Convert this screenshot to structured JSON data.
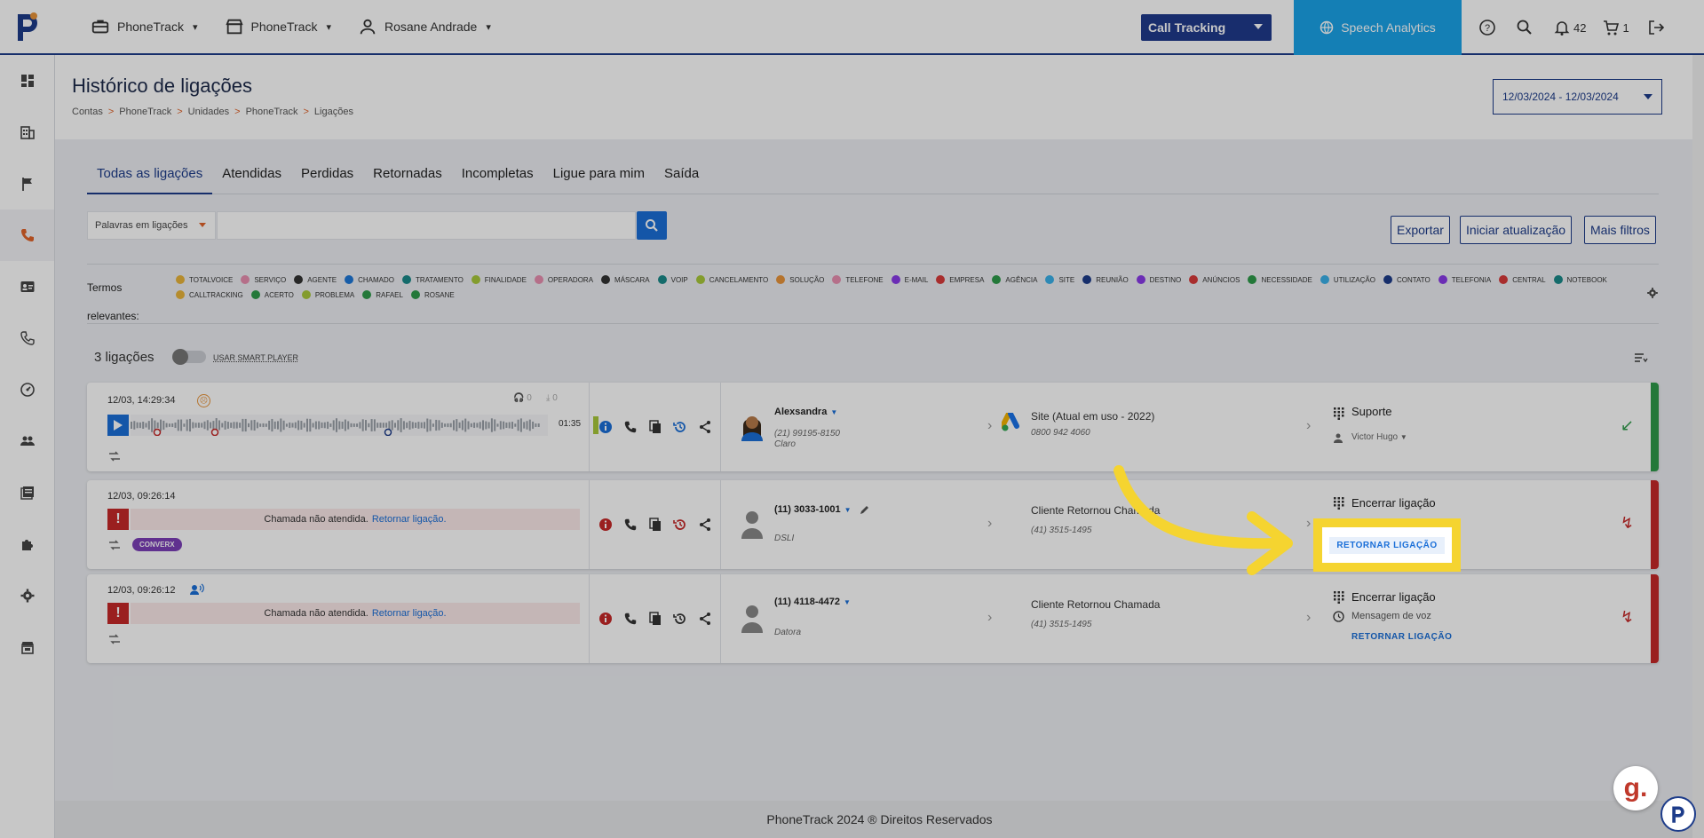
{
  "topbar": {
    "menus": [
      {
        "label": "PhoneTrack",
        "icon": "briefcase-icon"
      },
      {
        "label": "PhoneTrack",
        "icon": "store-icon"
      },
      {
        "label": "Rosane Andrade",
        "icon": "user-icon"
      }
    ],
    "product_select": "Call Tracking",
    "speech_analytics": "Speech Analytics",
    "notifications_count": "42",
    "cart_count": "1"
  },
  "sidebar": {
    "items": [
      "dashboard-icon",
      "building-icon",
      "flag-icon",
      "phone-icon",
      "contact-card-icon",
      "phone-outline-icon",
      "speed-icon",
      "users-icon",
      "reports-icon",
      "puzzle-icon",
      "settings-icon",
      "store-icon"
    ]
  },
  "header": {
    "title": "Histórico de ligações",
    "breadcrumb": [
      "Contas",
      "PhoneTrack",
      "Unidades",
      "PhoneTrack",
      "Ligações"
    ],
    "date_range": "12/03/2024 - 12/03/2024"
  },
  "tabs": [
    "Todas as ligações",
    "Atendidas",
    "Perdidas",
    "Retornadas",
    "Incompletas",
    "Ligue para mim",
    "Saída"
  ],
  "search": {
    "keyword_select": "Palavras em ligações",
    "input_value": ""
  },
  "actions": {
    "export": "Exportar",
    "start_update": "Iniciar atualização",
    "more_filters": "Mais filtros"
  },
  "terms": {
    "label_line1": "Termos",
    "label_line2": "relevantes:",
    "items": [
      {
        "label": "TOTALVOICE",
        "color": "#e8b43a"
      },
      {
        "label": "SERVIÇO",
        "color": "#e88fb0"
      },
      {
        "label": "AGENTE",
        "color": "#333333"
      },
      {
        "label": "CHAMADO",
        "color": "#1e78d8"
      },
      {
        "label": "TRATAMENTO",
        "color": "#1a8a8a"
      },
      {
        "label": "FINALIDADE",
        "color": "#a8c83a"
      },
      {
        "label": "OPERADORA",
        "color": "#e88fb0"
      },
      {
        "label": "MÁSCARA",
        "color": "#333333"
      },
      {
        "label": "VOIP",
        "color": "#1a8a8a"
      },
      {
        "label": "CANCELAMENTO",
        "color": "#a8c83a"
      },
      {
        "label": "SOLUÇÃO",
        "color": "#e8943a"
      },
      {
        "label": "TELEFONE",
        "color": "#e88fb0"
      },
      {
        "label": "E-MAIL",
        "color": "#8a3ae8"
      },
      {
        "label": "EMPRESA",
        "color": "#d83a3a"
      },
      {
        "label": "AGÊNCIA",
        "color": "#2e9a4a"
      },
      {
        "label": "SITE",
        "color": "#3ab0e8"
      },
      {
        "label": "REUNIÃO",
        "color": "#1d3c8a"
      },
      {
        "label": "DESTINO",
        "color": "#8a3ae8"
      },
      {
        "label": "ANÚNCIOS",
        "color": "#d83a3a"
      },
      {
        "label": "NECESSIDADE",
        "color": "#2e9a4a"
      },
      {
        "label": "UTILIZAÇÃO",
        "color": "#3ab0e8"
      },
      {
        "label": "CONTATO",
        "color": "#1d3c8a"
      },
      {
        "label": "TELEFONIA",
        "color": "#8a3ae8"
      },
      {
        "label": "CENTRAL",
        "color": "#d83a3a"
      },
      {
        "label": "NOTEBOOK",
        "color": "#1a8a8a"
      },
      {
        "label": "CALLTRACKING",
        "color": "#e8b43a"
      },
      {
        "label": "ACERTO",
        "color": "#2e9a4a"
      },
      {
        "label": "PROBLEMA",
        "color": "#a8c83a"
      },
      {
        "label": "RAFAEL",
        "color": "#2e9a4a"
      },
      {
        "label": "ROSANE",
        "color": "#2e9a4a"
      }
    ]
  },
  "list": {
    "count": "3 ligações",
    "smart_player": "USAR SMART PLAYER"
  },
  "calls": [
    {
      "datetime": "12/03, 14:29:34",
      "listen_count": "0",
      "download_count": "0",
      "duration": "01:35",
      "contact_name": "Alexsandra",
      "contact_phone": "(21) 99195-8150",
      "contact_carrier": "Claro",
      "source_name": "Site (Atual em uso - 2022)",
      "source_phone": "0800 942 4060",
      "dest_title": "Suporte",
      "dest_agent": "Victor Hugo",
      "status_color": "#2e9a4a"
    },
    {
      "datetime": "12/03, 09:26:14",
      "missed_msg": "Chamada não atendida.",
      "missed_link": "Retornar ligação.",
      "badge": "CONVERX",
      "contact_name": "(11) 3033-1001",
      "contact_carrier": "DSLI",
      "source_name": "Cliente Retornou Chamada",
      "source_phone": "(41) 3515-1495",
      "dest_title": "Encerrar ligação",
      "return_label": "RETORNAR LIGAÇÃO",
      "status_color": "#c62828"
    },
    {
      "datetime": "12/03, 09:26:12",
      "missed_msg": "Chamada não atendida.",
      "missed_link": "Retornar ligação.",
      "contact_name": "(11) 4118-4472",
      "contact_carrier": "Datora",
      "source_name": "Cliente Retornou Chamada",
      "source_phone": "(41) 3515-1495",
      "dest_title": "Encerrar ligação",
      "dest_sub": "Mensagem de voz",
      "return_label": "RETORNAR LIGAÇÃO",
      "status_color": "#c62828"
    }
  ],
  "footer": "PhoneTrack 2024 ® Direitos Reservados"
}
